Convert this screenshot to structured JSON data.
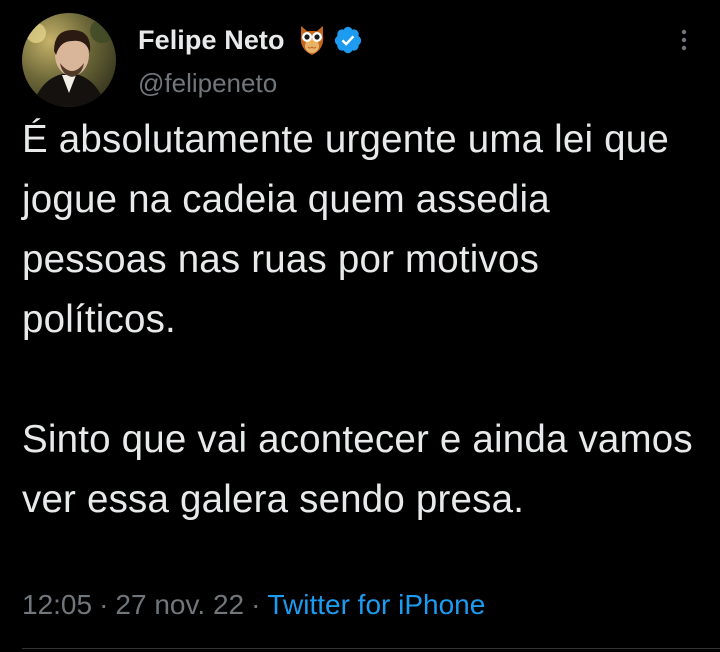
{
  "author": {
    "display_name": "Felipe Neto",
    "handle": "@felipeneto",
    "badges": [
      "owl-icon",
      "verified-badge-icon"
    ]
  },
  "tweet": {
    "paragraph_1": "É absolutamente urgente uma lei que jogue na cadeia quem assedia pessoas nas ruas por motivos políticos.",
    "paragraph_2": "Sinto que vai acontecer e ainda vamos ver essa galera sendo presa."
  },
  "meta": {
    "time": "12:05",
    "separator": "·",
    "date": "27 nov. 22",
    "source": "Twitter for iPhone"
  },
  "colors": {
    "background": "#000000",
    "text": "#e7e9ea",
    "secondary": "#71767b",
    "link": "#1d9bf0",
    "verified": "#1d9bf0"
  }
}
